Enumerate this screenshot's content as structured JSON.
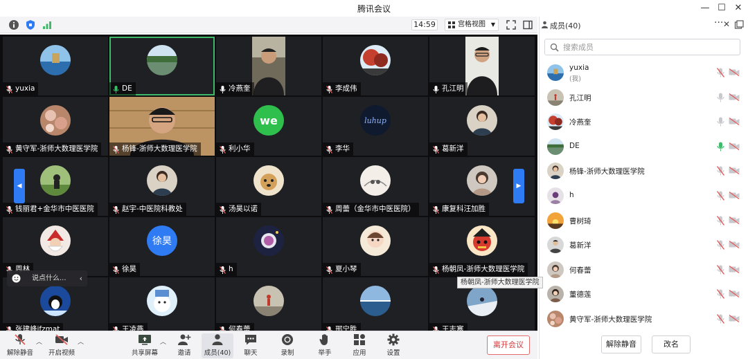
{
  "app": {
    "title": "腾讯会议"
  },
  "topbar": {
    "clock": "14:59",
    "view_label": "宫格视图"
  },
  "tiles": [
    {
      "name": "yuxia"
    },
    {
      "name": "DE"
    },
    {
      "name": "冷燕奎"
    },
    {
      "name": "李成伟"
    },
    {
      "name": "孔江明"
    },
    {
      "name": "黄守军-浙师大数理医学院"
    },
    {
      "name": "杨锋-浙师大数理医学院"
    },
    {
      "name": "利小华"
    },
    {
      "name": "李华"
    },
    {
      "name": "葛新洋"
    },
    {
      "name": "钱丽君+金华市中医医院"
    },
    {
      "name": "赵宇-中医院科教处"
    },
    {
      "name": "汤昊以诺"
    },
    {
      "name": "周蕾（金华市中医医院）"
    },
    {
      "name": "康复科汪加胜"
    },
    {
      "name": "周林"
    },
    {
      "name": "徐昊",
      "avatar_text": "徐昊"
    },
    {
      "name": "h"
    },
    {
      "name": "夏小琴"
    },
    {
      "name": "杨朝凤-浙师大数理医学院"
    },
    {
      "name": "张建峰jfzmat"
    },
    {
      "name": "王凌燕"
    },
    {
      "name": "何春蕾"
    },
    {
      "name": "邢宁胜"
    },
    {
      "name": "王志寒"
    }
  ],
  "chat": {
    "placeholder": "说点什么..."
  },
  "tooltip": "杨朝凤-浙师大数理医学院",
  "toolbar": {
    "unmute": "解除静音",
    "start_video": "开启视频",
    "share": "共享屏幕",
    "invite": "邀请",
    "members": "成员(40)",
    "chat": "聊天",
    "record": "录制",
    "raise_hand": "举手",
    "apps": "应用",
    "settings": "设置",
    "leave": "离开会议"
  },
  "panel": {
    "title": "成员(40)",
    "search_placeholder": "搜索成员",
    "members": [
      {
        "name": "yuxia",
        "sub": "(我)",
        "mic": "muted"
      },
      {
        "name": "孔江明",
        "mic": "idle"
      },
      {
        "name": "冷燕奎",
        "mic": "idle"
      },
      {
        "name": "DE",
        "mic": "active"
      },
      {
        "name": "杨锋-浙师大数理医学院",
        "mic": "muted"
      },
      {
        "name": "h",
        "mic": "muted"
      },
      {
        "name": "曹树琦",
        "mic": "muted"
      },
      {
        "name": "葛新洋",
        "mic": "muted"
      },
      {
        "name": "何春蕾",
        "mic": "muted"
      },
      {
        "name": "董德莲",
        "mic": "muted"
      },
      {
        "name": "黄守军-浙师大数理医学院",
        "mic": "muted"
      }
    ],
    "unmute_all": "解除静音",
    "rename": "改名"
  },
  "colors": {
    "accent": "#2f7bf3",
    "active_speaker": "#3fba6a",
    "leave": "#d6393c",
    "muted": "#e25a5a"
  }
}
